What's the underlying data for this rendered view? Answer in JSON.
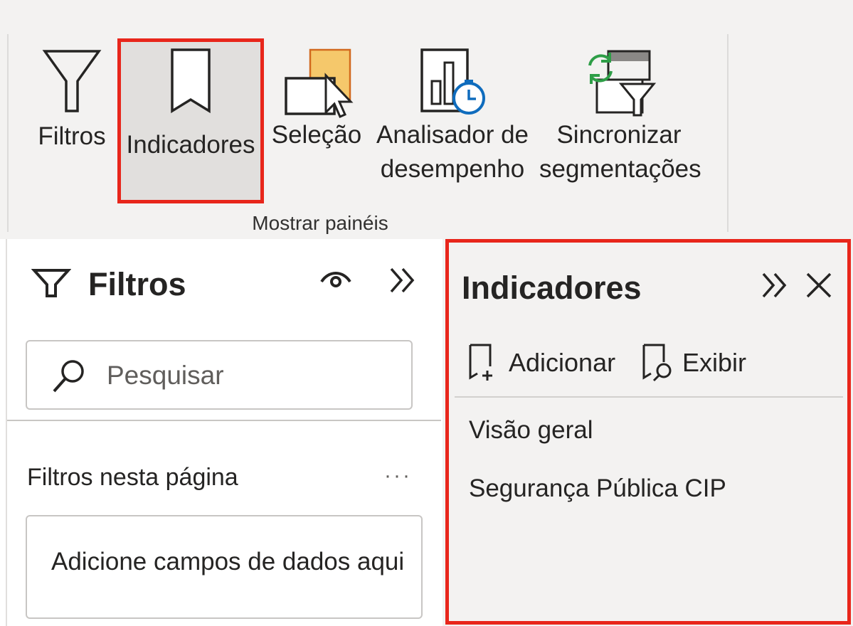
{
  "ribbon": {
    "group_label": "Mostrar painéis",
    "buttons": [
      {
        "id": "filtros",
        "label": "Filtros",
        "icon": "funnel-icon"
      },
      {
        "id": "indicadores",
        "label": "Indicadores",
        "icon": "bookmark-icon",
        "active": true
      },
      {
        "id": "selecao",
        "label": "Seleção",
        "icon": "selection-icon"
      },
      {
        "id": "analisador",
        "label": "Analisador de\ndesempenho",
        "icon": "performance-analyzer-icon"
      },
      {
        "id": "sincronizar",
        "label": "Sincronizar\nsegmentações",
        "icon": "sync-slicers-icon"
      }
    ]
  },
  "filters_pane": {
    "title": "Filtros",
    "search_placeholder": "Pesquisar",
    "section_label": "Filtros nesta página",
    "more_label": "···",
    "dropzone_text": "Adicione campos de dados aqui"
  },
  "bookmarks_pane": {
    "title": "Indicadores",
    "add_label": "Adicionar",
    "view_label": "Exibir",
    "items": [
      "Visão geral",
      "Segurança Pública CIP"
    ]
  },
  "colors": {
    "highlight_border": "#e8261b",
    "ribbon_bg": "#f3f2f1",
    "active_bg": "#e1dfdd",
    "pane_bg": "#ffffff"
  }
}
